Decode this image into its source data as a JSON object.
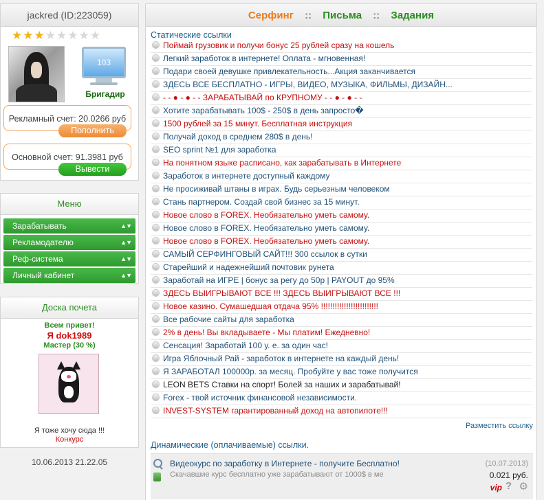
{
  "profile": {
    "username": "jackred (ID:223059)",
    "rating": 3,
    "max_rating": 8,
    "monitor_value": "103",
    "rank": "Бригадир",
    "ad_account": "Рекламный счет: 20.0266 руб",
    "topup_label": "Пополнить",
    "main_account": "Основной счет: 91.3981 руб",
    "withdraw_label": "Вывести"
  },
  "menu": {
    "title": "Меню",
    "items": [
      {
        "label": "Зарабатывать"
      },
      {
        "label": "Рекламодателю"
      },
      {
        "label": "Реф-система"
      },
      {
        "label": "Личный кабинет"
      }
    ]
  },
  "honor_board": {
    "title": "Доска почета",
    "greeting": "Всем привет!",
    "user": "Я dok1989",
    "level": "Мастер (30 %)",
    "cta": "Я тоже хочу сюда !!!",
    "contest": "Конкурс"
  },
  "date": "10.06.2013 21.22.05",
  "tabs": [
    "Серфинг",
    "Письма",
    "Задания"
  ],
  "tab_separator": "::",
  "static_title": "Статические ссылки",
  "static_links": [
    {
      "text": "Поймай грузовик и получи бонус 25 рублей сразу на кошель",
      "color": "red"
    },
    {
      "text": "Легкий заработок в интернете! Оплата - мгновенная!",
      "color": "blue"
    },
    {
      "text": "Подари своей девушке привлекательность...Акция заканчивается",
      "color": "blue"
    },
    {
      "text": "ЗДЕСЬ ВСЕ БЕСПЛАТНО - ИГРЫ, ВИДЕО, МУЗЫКА, ФИЛЬМЫ, ДИЗАЙН...",
      "color": "blue"
    },
    {
      "text": "- - ● - ● - - ЗАРАБАТЫВАЙ по КРУПНОМУ - - ● - ● - -",
      "color": "red"
    },
    {
      "text": "Хотите зарабатывать 100$ - 250$ в день запросто�",
      "color": "blue"
    },
    {
      "text": "1500 рублей за 15 минут. Бесплатная инструкция",
      "color": "red"
    },
    {
      "text": "Получай доход в среднем 280$ в день!",
      "color": "blue"
    },
    {
      "text": "SEO sprint №1 для заработка",
      "color": "blue"
    },
    {
      "text": "На понятном языке расписано, как зарабатывать в Интернете",
      "color": "red"
    },
    {
      "text": "Заработок в интернете доступный каждому",
      "color": "blue"
    },
    {
      "text": "Не просиживай штаны в играх. Будь серьезным человеком",
      "color": "blue"
    },
    {
      "text": "Стань партнером. Создай свой бизнес за 15 минут.",
      "color": "blue"
    },
    {
      "text": "Новое слово в FOREX. Необязательно уметь самому.",
      "color": "red"
    },
    {
      "text": "Новое слово в FOREX. Необязательно уметь самому.",
      "color": "blue"
    },
    {
      "text": "Новое слово в FOREX. Необязательно уметь самому.",
      "color": "red"
    },
    {
      "text": "САМЫЙ СЕРФИНГОВЫЙ САЙТ!!! 300 ссылок в сутки",
      "color": "blue"
    },
    {
      "text": "Старейший и надежнейший почтовик рунета",
      "color": "blue"
    },
    {
      "text": "Заработай на ИГРЕ | бонус за регу до 50р | PAYOUT до 95%",
      "color": "blue"
    },
    {
      "text": "ЗДЕСЬ ВЫИГРЫВАЮТ ВСЕ !!! ЗДЕСЬ ВЫИГРЫВАЮТ ВСЕ !!!",
      "color": "red"
    },
    {
      "text": "Новое казино. Сумашедшая отдача 95% !!!!!!!!!!!!!!!!!!!!!!!!!",
      "color": "red"
    },
    {
      "text": "Все рабочие сайты для заработка",
      "color": "blue"
    },
    {
      "text": "2% в день! Вы вкладываете - Мы платим! Ежедневно!",
      "color": "red"
    },
    {
      "text": "Сенсация! Заработай 100 у. е. за один час!",
      "color": "blue"
    },
    {
      "text": "Игра Яблочный Рай - заработок в интернете на каждый день!",
      "color": "blue"
    },
    {
      "text": "Я ЗАРАБОТАЛ 100000р. за месяц. Пробуйте у вас тоже получится",
      "color": "blue"
    },
    {
      "text": "LEON BETS Ставки на спорт! Болей за наших и зарабатывай!",
      "color": "black"
    },
    {
      "text": "Forex - твой источник финансовой независимости.",
      "color": "blue"
    },
    {
      "text": "INVEST-SYSTEM гарантированный доход на автопилоте!!!",
      "color": "red"
    }
  ],
  "place_link": "Разместить ссылку",
  "dynamic_title": "Динамические (оплачиваемые) ссылки.",
  "dynamic": {
    "title": "Видеокурс по заработку в Интернете - получите Бесплатно!",
    "subtitle": "Скачавшие курс бесплатно уже зарабатывают от 1000$ в ме",
    "date": "(10.07.2013)",
    "price": "0.021 руб.",
    "vip": "vip",
    "help": "?",
    "gear": "⚙"
  }
}
